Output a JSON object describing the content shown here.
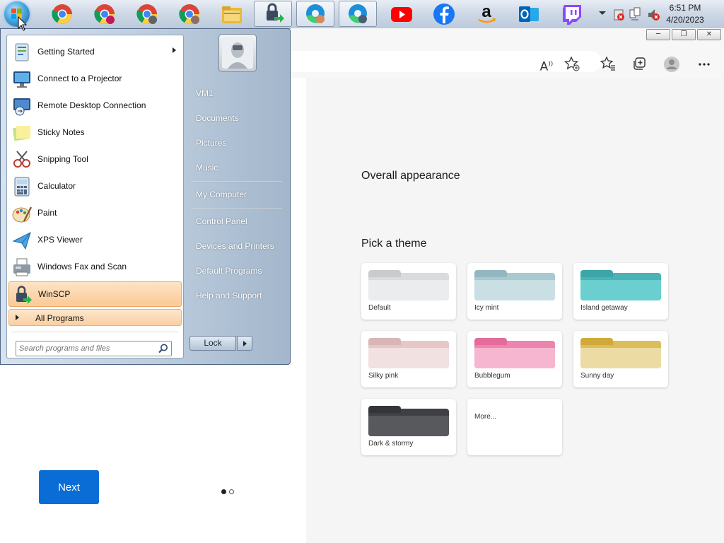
{
  "taskbar": {
    "clock_time": "6:51 PM",
    "clock_date": "4/20/2023",
    "pinned": [
      "chrome-icon",
      "chrome-profile-icon",
      "chrome-profile-icon",
      "chrome-profile-icon",
      "file-explorer-icon",
      "winscp-icon",
      "edge-profile-icon",
      "edge-icon",
      "youtube-icon",
      "facebook-icon",
      "amazon-icon",
      "outlook-icon",
      "twitch-icon"
    ]
  },
  "start_menu": {
    "programs": [
      {
        "label": "Getting Started",
        "icon": "getting-started-icon",
        "submenu": true
      },
      {
        "label": "Connect to a Projector",
        "icon": "projector-icon"
      },
      {
        "label": "Remote Desktop Connection",
        "icon": "remote-desktop-icon"
      },
      {
        "label": "Sticky Notes",
        "icon": "sticky-notes-icon"
      },
      {
        "label": "Snipping Tool",
        "icon": "snipping-tool-icon"
      },
      {
        "label": "Calculator",
        "icon": "calculator-icon"
      },
      {
        "label": "Paint",
        "icon": "paint-icon"
      },
      {
        "label": "XPS Viewer",
        "icon": "xps-viewer-icon"
      },
      {
        "label": "Windows Fax and Scan",
        "icon": "fax-scan-icon"
      },
      {
        "label": "WinSCP",
        "icon": "winscp-icon",
        "highlighted": true
      }
    ],
    "all_programs": "All Programs",
    "search_placeholder": "Search programs and files",
    "right_items": [
      "VM1",
      "Documents",
      "Pictures",
      "Music",
      "My Computer",
      "Control Panel",
      "Devices and Printers",
      "Default Programs",
      "Help and Support"
    ],
    "lock_label": "Lock"
  },
  "browser": {
    "window_controls": {
      "minimize": "─",
      "restore": "❐",
      "close": "✕"
    },
    "toolbar_icons": [
      "read-aloud-icon",
      "add-favorite-icon",
      "favorites-icon",
      "collections-icon",
      "profile-icon",
      "more-icon"
    ],
    "overall_appearance": "Overall appearance",
    "pick_theme": "Pick a theme",
    "themes": [
      {
        "label": "Default",
        "tab": "#c9cccf",
        "back": "#d9dbdd",
        "front": "#ebecee"
      },
      {
        "label": "Icy mint",
        "tab": "#93b7c0",
        "back": "#a9c8cf",
        "front": "#cadfe3"
      },
      {
        "label": "Island getaway",
        "tab": "#3ba5a7",
        "back": "#4bb3b5",
        "front": "#6bcfd0"
      },
      {
        "label": "Silky pink",
        "tab": "#d9b5b5",
        "back": "#e5c7c7",
        "front": "#f2e1e1"
      },
      {
        "label": "Bubblegum",
        "tab": "#e56b9a",
        "back": "#ec85ad",
        "front": "#f7b6cf"
      },
      {
        "label": "Sunny day",
        "tab": "#d1a93a",
        "back": "#dcbd5c",
        "front": "#ecdca4"
      },
      {
        "label": "Dark & stormy",
        "tab": "#333538",
        "back": "#3e4043",
        "front": "#57595c"
      }
    ],
    "more_label": "More...",
    "next_label": "Next",
    "page_dots": {
      "total": 2,
      "active": 1
    }
  }
}
